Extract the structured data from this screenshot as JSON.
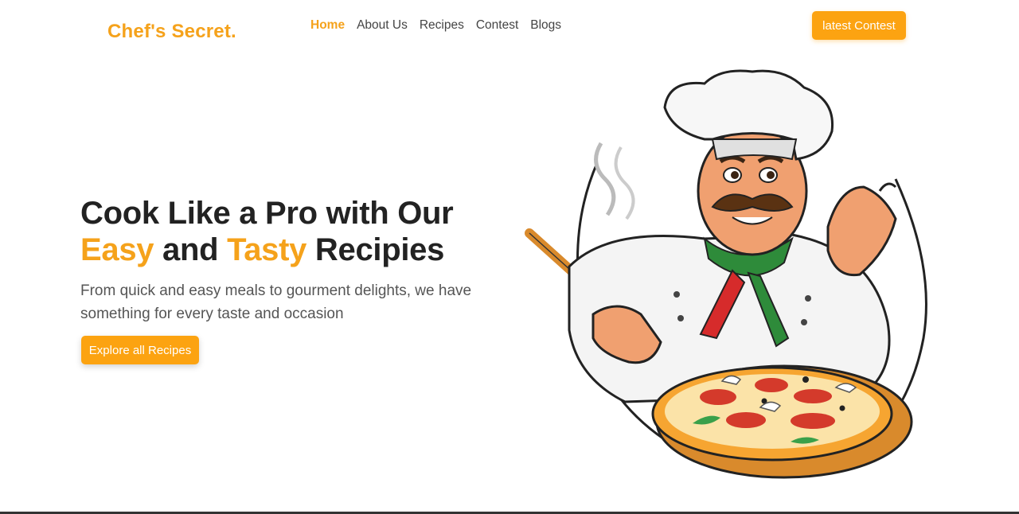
{
  "brand": {
    "name": "Chef's Secret."
  },
  "nav": {
    "items": [
      {
        "label": "Home",
        "active": true
      },
      {
        "label": "About Us",
        "active": false
      },
      {
        "label": "Recipes",
        "active": false
      },
      {
        "label": "Contest",
        "active": false
      },
      {
        "label": "Blogs",
        "active": false
      }
    ],
    "cta_label": "latest Contest"
  },
  "hero": {
    "title_line1": "Cook Like a Pro with Our",
    "title_hl1": "Easy",
    "title_and": " and ",
    "title_hl2": "Tasty",
    "title_end": " Recipies",
    "subtitle": "From quick and easy meals to gourment delights, we have something for every taste and occasion",
    "button_label": "Explore all Recipes"
  },
  "illustration": {
    "name": "chef-with-pizza-illustration"
  },
  "colors": {
    "accent": "#f5a21b",
    "button": "#fca311",
    "text": "#222222"
  }
}
